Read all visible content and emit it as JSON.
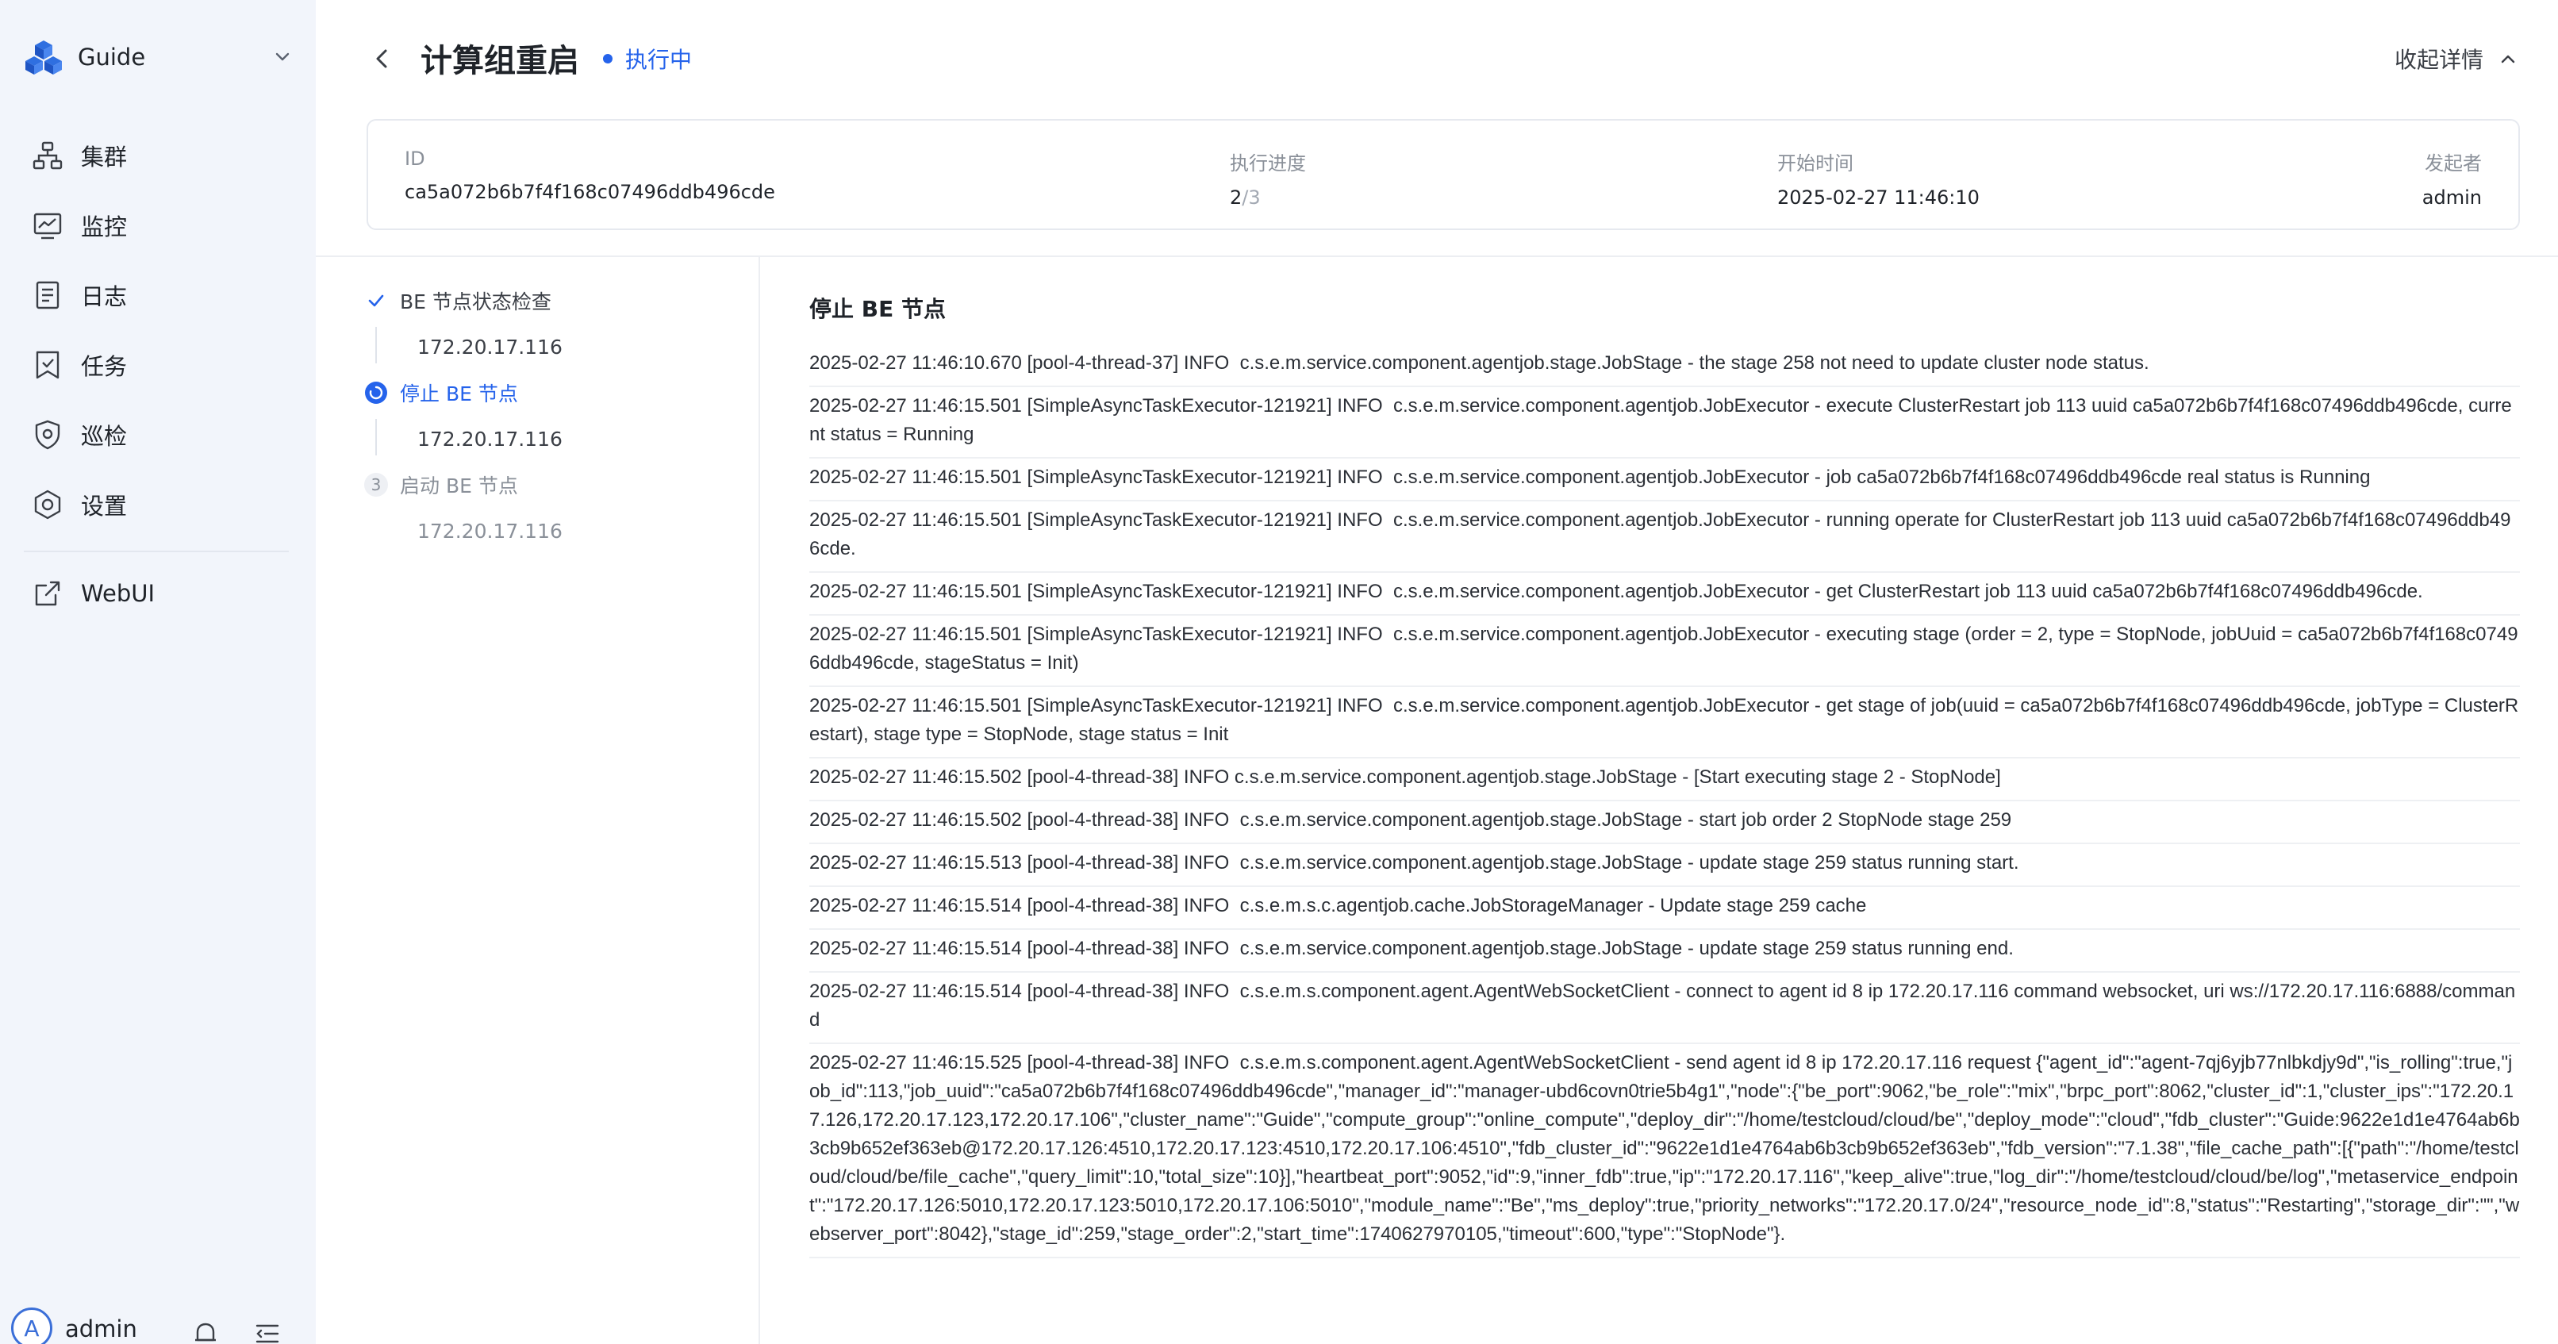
{
  "app": {
    "cluster_name": "Guide",
    "user": {
      "name": "admin",
      "avatar_letter": "A"
    }
  },
  "sidebar": {
    "items": [
      {
        "label": "集群",
        "icon": "cluster-icon"
      },
      {
        "label": "监控",
        "icon": "monitor-icon"
      },
      {
        "label": "日志",
        "icon": "log-icon"
      },
      {
        "label": "任务",
        "icon": "task-icon"
      },
      {
        "label": "巡检",
        "icon": "inspection-icon"
      },
      {
        "label": "设置",
        "icon": "settings-icon"
      }
    ],
    "webui": {
      "label": "WebUI",
      "icon": "external-link-icon"
    }
  },
  "header": {
    "title": "计算组重启",
    "status": "执行中",
    "collapse_label": "收起详情"
  },
  "info": {
    "id_label": "ID",
    "id_value": "ca5a072b6b7f4f168c07496ddb496cde",
    "progress_label": "执行进度",
    "progress_done": "2",
    "progress_total": "/3",
    "start_label": "开始时间",
    "start_value": "2025-02-27 11:46:10",
    "initiator_label": "发起者",
    "initiator_value": "admin"
  },
  "steps": [
    {
      "title": "BE 节点状态检查",
      "ip": "172.20.17.116",
      "state": "done"
    },
    {
      "title": "停止 BE 节点",
      "ip": "172.20.17.116",
      "state": "active"
    },
    {
      "title": "启动 BE 节点",
      "ip": "172.20.17.116",
      "state": "pending",
      "number": "3"
    }
  ],
  "log": {
    "title": "停止 BE 节点",
    "lines": [
      "2025-02-27 11:46:10.670 [pool-4-thread-37] INFO  c.s.e.m.service.component.agentjob.stage.JobStage - the stage 258 not need to update cluster node status.",
      "2025-02-27 11:46:15.501 [SimpleAsyncTaskExecutor-121921] INFO  c.s.e.m.service.component.agentjob.JobExecutor - execute ClusterRestart job 113 uuid ca5a072b6b7f4f168c07496ddb496cde, current status = Running",
      "2025-02-27 11:46:15.501 [SimpleAsyncTaskExecutor-121921] INFO  c.s.e.m.service.component.agentjob.JobExecutor - job ca5a072b6b7f4f168c07496ddb496cde real status is Running",
      "2025-02-27 11:46:15.501 [SimpleAsyncTaskExecutor-121921] INFO  c.s.e.m.service.component.agentjob.JobExecutor - running operate for ClusterRestart job 113 uuid ca5a072b6b7f4f168c07496ddb496cde.",
      "2025-02-27 11:46:15.501 [SimpleAsyncTaskExecutor-121921] INFO  c.s.e.m.service.component.agentjob.JobExecutor - get ClusterRestart job 113 uuid ca5a072b6b7f4f168c07496ddb496cde.",
      "2025-02-27 11:46:15.501 [SimpleAsyncTaskExecutor-121921] INFO  c.s.e.m.service.component.agentjob.JobExecutor - executing stage (order = 2, type = StopNode, jobUuid = ca5a072b6b7f4f168c07496ddb496cde, stageStatus = Init)",
      "2025-02-27 11:46:15.501 [SimpleAsyncTaskExecutor-121921] INFO  c.s.e.m.service.component.agentjob.JobExecutor - get stage of job(uuid = ca5a072b6b7f4f168c07496ddb496cde, jobType = ClusterRestart), stage type = StopNode, stage status = Init",
      "2025-02-27 11:46:15.502 [pool-4-thread-38] INFO c.s.e.m.service.component.agentjob.stage.JobStage - [Start executing stage 2 - StopNode]",
      "2025-02-27 11:46:15.502 [pool-4-thread-38] INFO  c.s.e.m.service.component.agentjob.stage.JobStage - start job order 2 StopNode stage 259",
      "2025-02-27 11:46:15.513 [pool-4-thread-38] INFO  c.s.e.m.service.component.agentjob.stage.JobStage - update stage 259 status running start.",
      "2025-02-27 11:46:15.514 [pool-4-thread-38] INFO  c.s.e.m.s.c.agentjob.cache.JobStorageManager - Update stage 259 cache",
      "2025-02-27 11:46:15.514 [pool-4-thread-38] INFO  c.s.e.m.service.component.agentjob.stage.JobStage - update stage 259 status running end.",
      "2025-02-27 11:46:15.514 [pool-4-thread-38] INFO  c.s.e.m.s.component.agent.AgentWebSocketClient - connect to agent id 8 ip 172.20.17.116 command websocket, uri ws://172.20.17.116:6888/command",
      "2025-02-27 11:46:15.525 [pool-4-thread-38] INFO  c.s.e.m.s.component.agent.AgentWebSocketClient - send agent id 8 ip 172.20.17.116 request {\"agent_id\":\"agent-7qj6yjb77nlbkdjy9d\",\"is_rolling\":true,\"job_id\":113,\"job_uuid\":\"ca5a072b6b7f4f168c07496ddb496cde\",\"manager_id\":\"manager-ubd6covn0trie5b4g1\",\"node\":{\"be_port\":9062,\"be_role\":\"mix\",\"brpc_port\":8062,\"cluster_id\":1,\"cluster_ips\":\"172.20.17.126,172.20.17.123,172.20.17.106\",\"cluster_name\":\"Guide\",\"compute_group\":\"online_compute\",\"deploy_dir\":\"/home/testcloud/cloud/be\",\"deploy_mode\":\"cloud\",\"fdb_cluster\":\"Guide:9622e1d1e4764ab6b3cb9b652ef363eb@172.20.17.126:4510,172.20.17.123:4510,172.20.17.106:4510\",\"fdb_cluster_id\":\"9622e1d1e4764ab6b3cb9b652ef363eb\",\"fdb_version\":\"7.1.38\",\"file_cache_path\":[{\"path\":\"/home/testcloud/cloud/be/file_cache\",\"query_limit\":10,\"total_size\":10}],\"heartbeat_port\":9052,\"id\":9,\"inner_fdb\":true,\"ip\":\"172.20.17.116\",\"keep_alive\":true,\"log_dir\":\"/home/testcloud/cloud/be/log\",\"metaservice_endpoint\":\"172.20.17.126:5010,172.20.17.123:5010,172.20.17.106:5010\",\"module_name\":\"Be\",\"ms_deploy\":true,\"priority_networks\":\"172.20.17.0/24\",\"resource_node_id\":8,\"status\":\"Restarting\",\"storage_dir\":\"\",\"webserver_port\":8042},\"stage_id\":259,\"stage_order\":2,\"start_time\":1740627970105,\"timeout\":600,\"type\":\"StopNode\"}."
    ]
  }
}
